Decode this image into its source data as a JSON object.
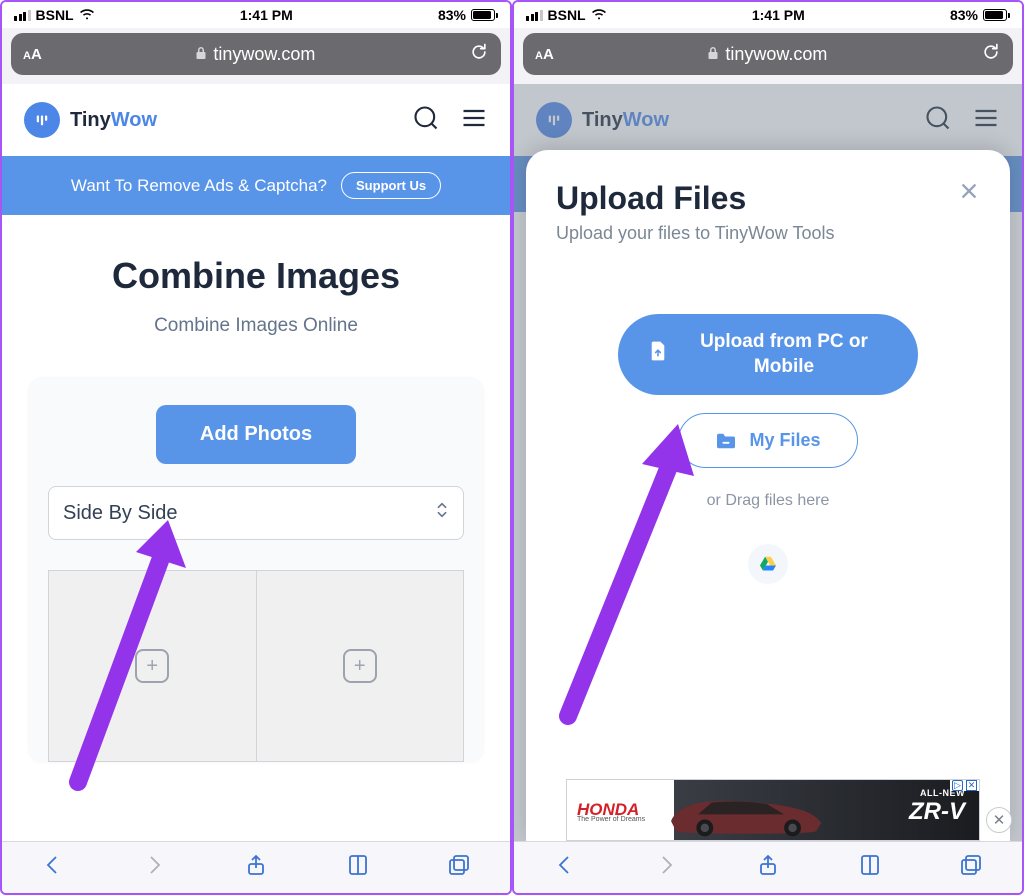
{
  "status": {
    "carrier": "BSNL",
    "time": "1:41 PM",
    "battery_pct": "83%",
    "battery_fill_pct": 83
  },
  "browser": {
    "domain": "tinywow.com"
  },
  "brand": {
    "name_a": "Tiny",
    "name_b": "Wow"
  },
  "promo": {
    "text": "Want To Remove Ads & Captcha?",
    "button": "Support Us"
  },
  "left": {
    "title": "Combine Images",
    "subtitle": "Combine Images Online",
    "add_button": "Add Photos",
    "layout_select": "Side By Side"
  },
  "modal": {
    "title": "Upload Files",
    "subtitle": "Upload your files to TinyWow Tools",
    "upload_pc": "Upload from PC or Mobile",
    "my_files": "My Files",
    "drag": "or Drag files here"
  },
  "ad": {
    "brand": "HONDA",
    "tagline": "The Power of Dreams",
    "line1": "ALL-NEW",
    "model": "ZR-V",
    "adchoices": "i"
  }
}
